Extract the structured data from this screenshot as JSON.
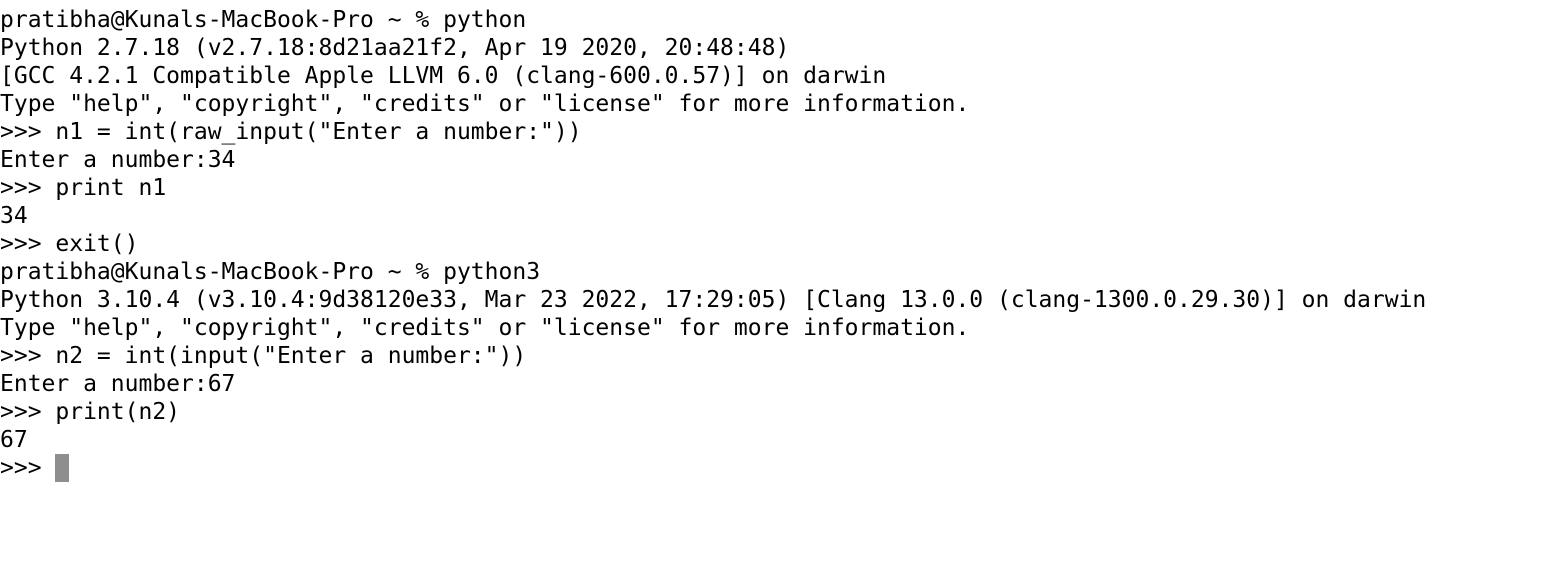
{
  "terminal": {
    "lines": [
      "pratibha@Kunals-MacBook-Pro ~ % python",
      "Python 2.7.18 (v2.7.18:8d21aa21f2, Apr 19 2020, 20:48:48)",
      "[GCC 4.2.1 Compatible Apple LLVM 6.0 (clang-600.0.57)] on darwin",
      "Type \"help\", \"copyright\", \"credits\" or \"license\" for more information.",
      ">>> n1 = int(raw_input(\"Enter a number:\"))",
      "Enter a number:34",
      ">>> print n1",
      "34",
      ">>> exit()",
      "pratibha@Kunals-MacBook-Pro ~ % python3",
      "Python 3.10.4 (v3.10.4:9d38120e33, Mar 23 2022, 17:29:05) [Clang 13.0.0 (clang-1300.0.29.30)] on darwin",
      "Type \"help\", \"copyright\", \"credits\" or \"license\" for more information.",
      ">>> n2 = int(input(\"Enter a number:\"))",
      "Enter a number:67",
      ">>> print(n2)",
      "67"
    ],
    "current_prompt": ">>> "
  }
}
